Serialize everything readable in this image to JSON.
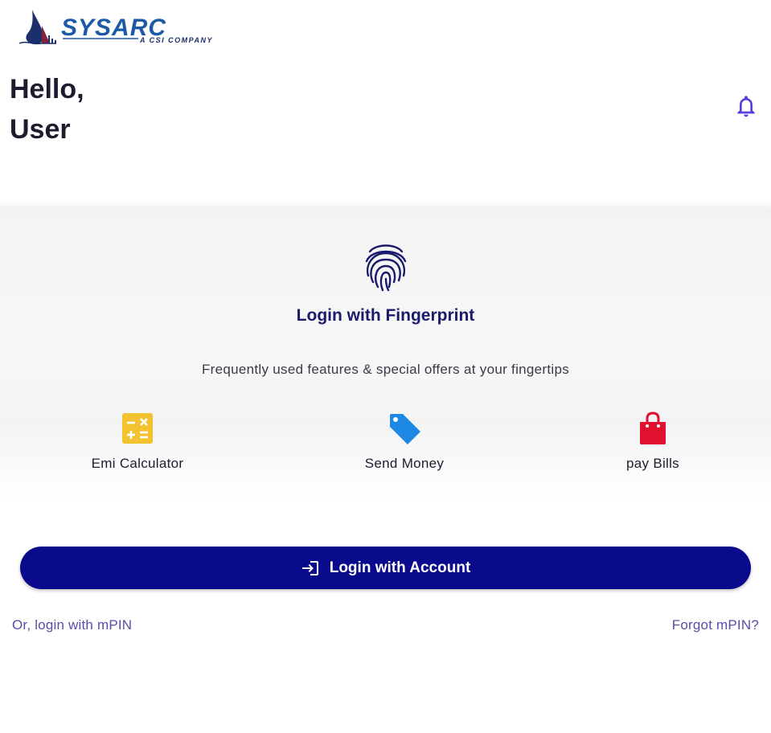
{
  "brand": {
    "logo_text": "SYSARC",
    "logo_tagline": "A CSI COMPANY"
  },
  "greeting": {
    "line1": "Hello,",
    "line2": "User"
  },
  "icons": {
    "notifications": "bell-icon",
    "fingerprint": "fingerprint-icon",
    "emi": "calculator-icon",
    "send": "tag-icon",
    "pay": "shopping-bag-icon",
    "login": "login-icon"
  },
  "quick_access": {
    "fingerprint_label": "Login with Fingerprint",
    "subtitle": "Frequently used features & special offers at your fingertips",
    "features": [
      {
        "label": "Emi Calculator",
        "color": "#f2c230"
      },
      {
        "label": "Send Money",
        "color": "#1e88e5"
      },
      {
        "label": "pay Bills",
        "color": "#e0102f"
      }
    ]
  },
  "actions": {
    "login_account": "Login with Account",
    "login_mpin": "Or, login with mPIN",
    "forgot_mpin": "Forgot mPIN?"
  },
  "colors": {
    "primary": "#0a0a8c",
    "link": "#5b4ca8",
    "bell": "#5a3de0"
  }
}
